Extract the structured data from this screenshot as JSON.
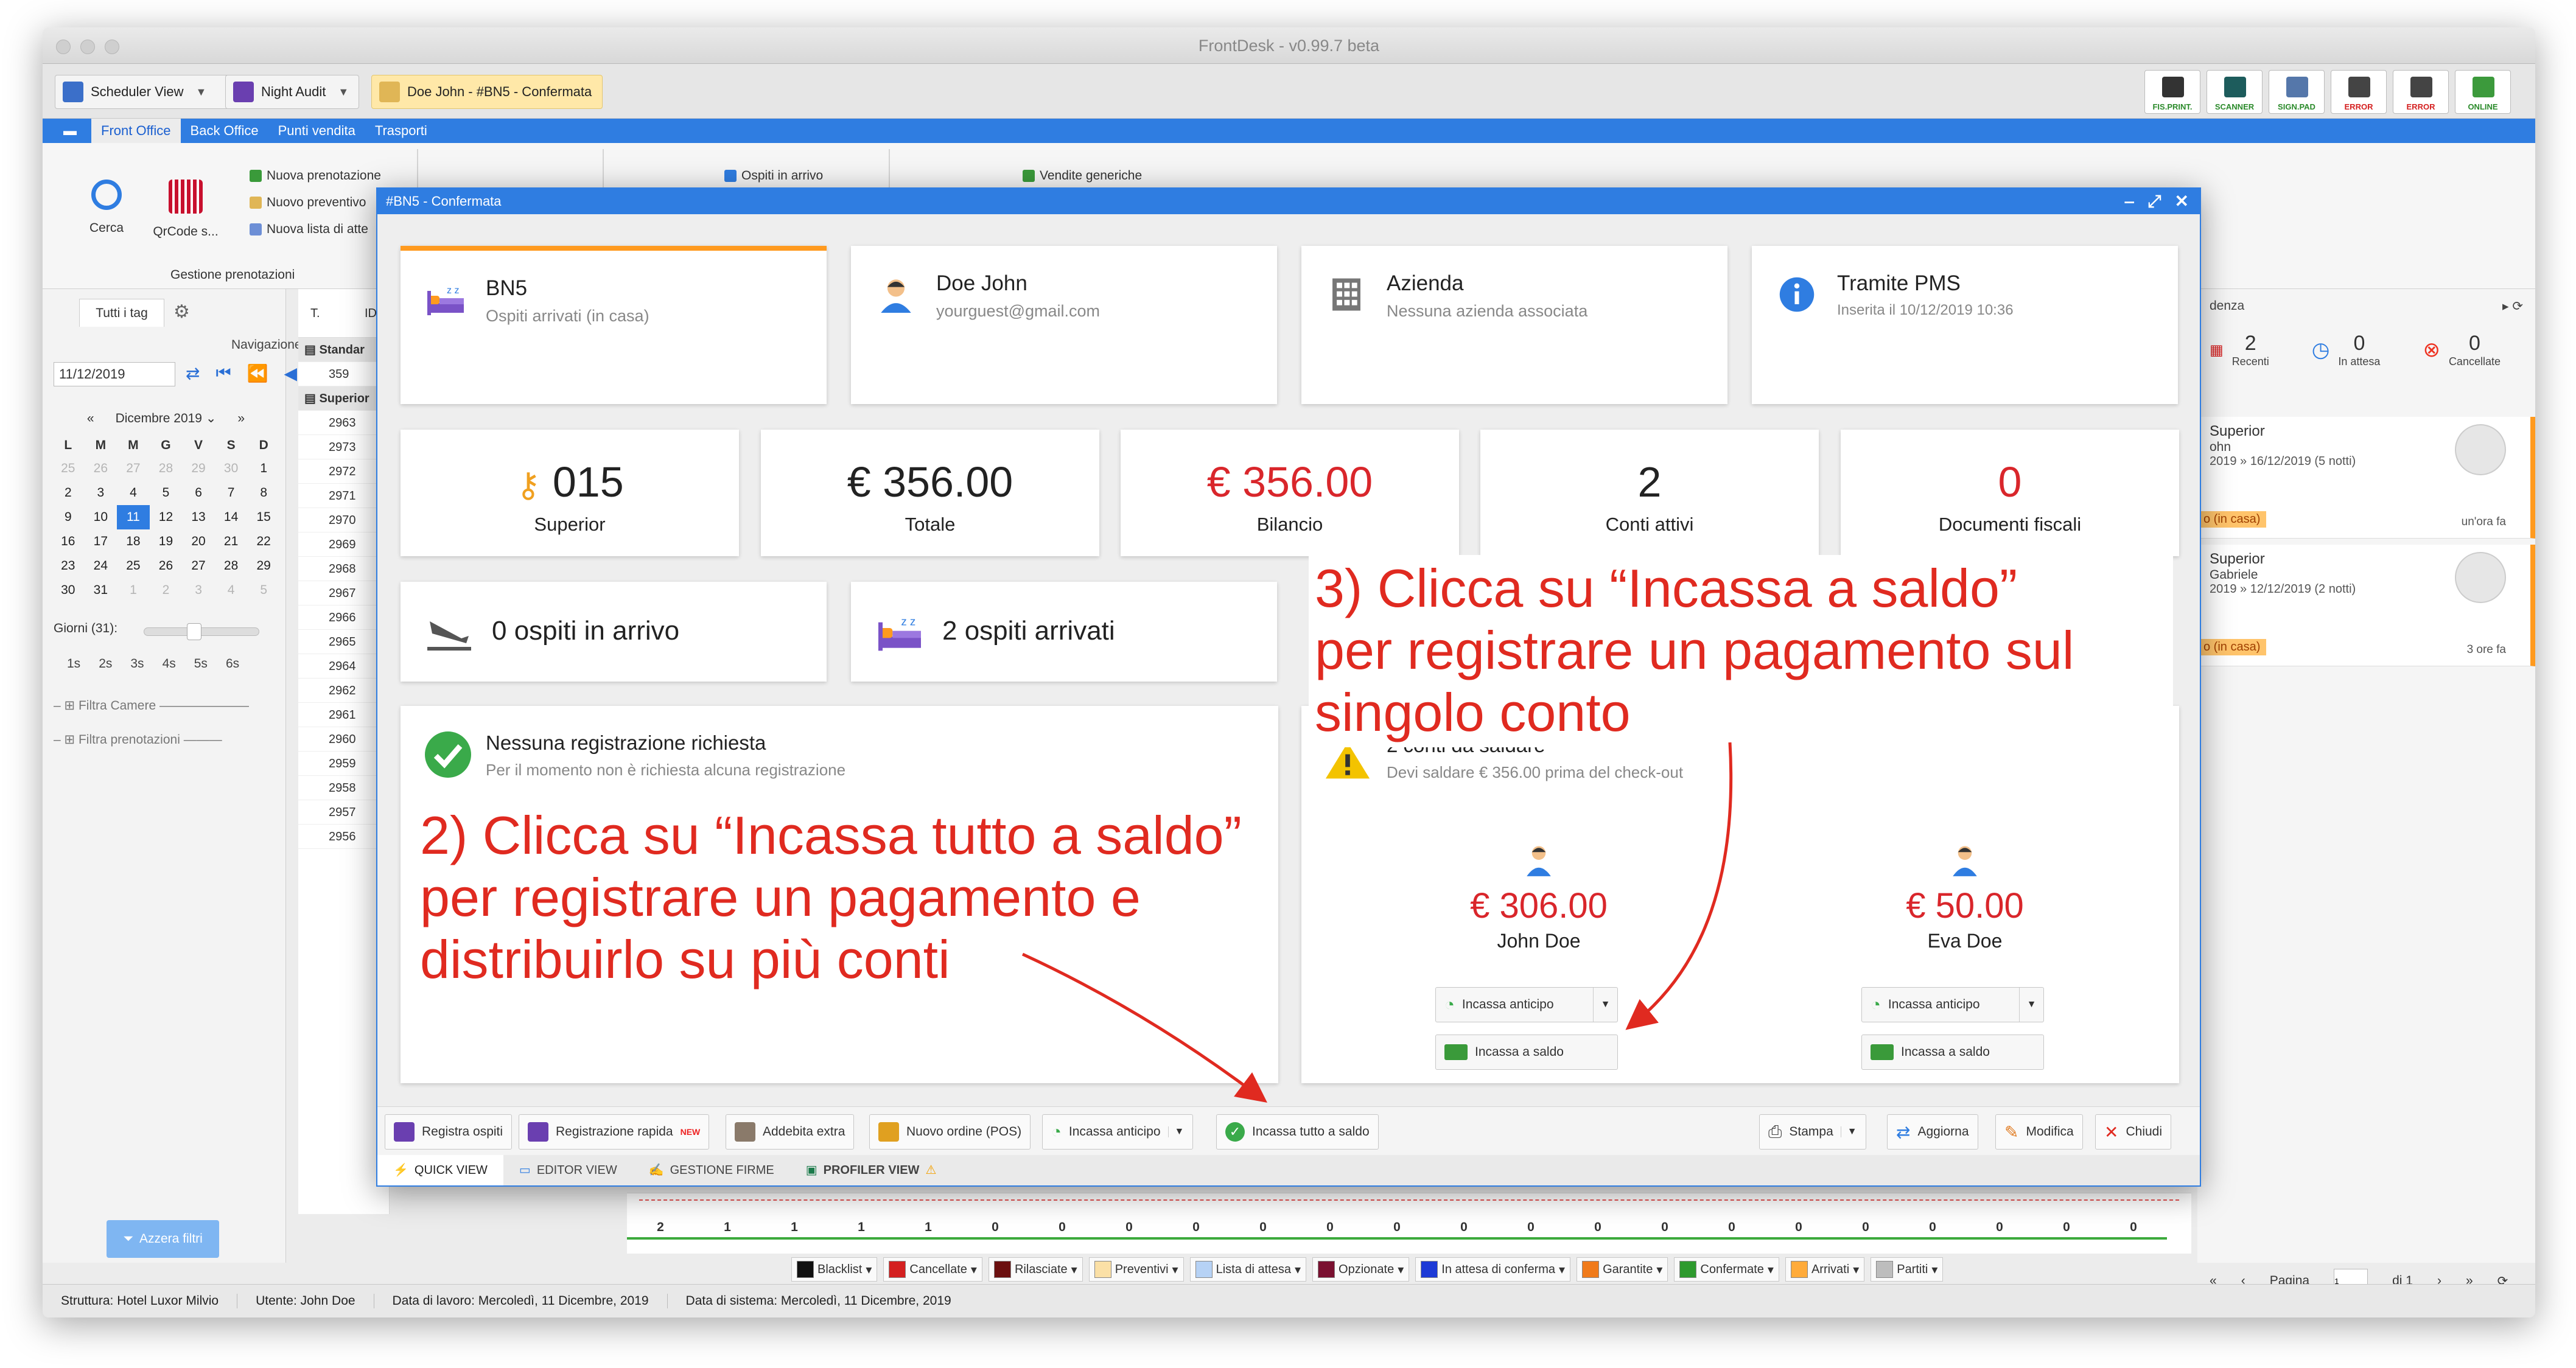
{
  "window": {
    "title": "FrontDesk - v0.99.7 beta"
  },
  "toolbar": {
    "scheduler_view": "Scheduler View",
    "night_audit": "Night Audit",
    "reservation_tab": "Doe John - #BN5 - Confermata",
    "devices": [
      "FIS.PRINT.",
      "SCANNER",
      "SIGN.PAD",
      "ERROR",
      "ERROR",
      "ONLINE"
    ]
  },
  "menu": {
    "items": [
      "Front Office",
      "Back Office",
      "Punti vendita",
      "Trasporti"
    ]
  },
  "ribbon": {
    "cerca": "Cerca",
    "qrcode": "QrCode s...",
    "nuova_prenotazione": "Nuova prenotazione",
    "nuovo_preventivo": "Nuovo preventivo",
    "nuova_lista": "Nuova lista di atte",
    "group_label": "Gestione prenotazioni",
    "ospiti_in_arrivo": "Ospiti in arrivo",
    "vendite_generiche": "Vendite generiche"
  },
  "left": {
    "tab": "Tutti i tag",
    "navigazione": "Navigazione",
    "date": "11/12/2019",
    "month": "Dicembre 2019",
    "weekdays": [
      "L",
      "M",
      "M",
      "G",
      "V",
      "S",
      "D"
    ],
    "weeks": [
      [
        "25",
        "26",
        "27",
        "28",
        "29",
        "30",
        "1"
      ],
      [
        "2",
        "3",
        "4",
        "5",
        "6",
        "7",
        "8"
      ],
      [
        "9",
        "10",
        "11",
        "12",
        "13",
        "14",
        "15"
      ],
      [
        "16",
        "17",
        "18",
        "19",
        "20",
        "21",
        "22"
      ],
      [
        "23",
        "24",
        "25",
        "26",
        "27",
        "28",
        "29"
      ],
      [
        "30",
        "31",
        "1",
        "2",
        "3",
        "4",
        "5"
      ]
    ],
    "giorni": "Giorni (31):",
    "spans": [
      "1s",
      "2s",
      "3s",
      "4s",
      "5s",
      "6s"
    ],
    "filtra_camere": "Filtra Camere",
    "filtra_prenotazioni": "Filtra prenotazioni",
    "azzera": "Azzera filtri"
  },
  "grid": {
    "col_t": "T.",
    "col_id": "ID",
    "group1": "Standar",
    "group1_rooms": [
      "359"
    ],
    "group2": "Superior",
    "group2_rooms": [
      "2963",
      "2973",
      "2972",
      "2971",
      "2970",
      "2969",
      "2968",
      "2967",
      "2966",
      "2965",
      "2964",
      "2962",
      "2961",
      "2960",
      "2959",
      "2958",
      "2957",
      "2956"
    ],
    "counts": [
      "2",
      "1",
      "1",
      "1",
      "1",
      "0",
      "0",
      "0",
      "0",
      "0",
      "0",
      "0",
      "0",
      "0",
      "0",
      "0",
      "0",
      "0",
      "0",
      "0",
      "0",
      "0",
      "0"
    ]
  },
  "legend": [
    "Blacklist",
    "Cancellate",
    "Rilasciate",
    "Preventivi",
    "Lista di attesa",
    "Opzionate",
    "In attesa di conferma",
    "Garantite",
    "Confermate",
    "Arrivati",
    "Partiti"
  ],
  "colors": {
    "accent": "#2f7de1",
    "red": "#d9262b",
    "orange": "#ff9a1f",
    "legend": [
      "#111111",
      "#d42020",
      "#6b0f0f",
      "#fbe0a6",
      "#b6d2f5",
      "#7a1030",
      "#1d3ad6",
      "#f07a1a",
      "#2e9a2e",
      "#ffab3a",
      "#bdbdbd"
    ]
  },
  "status": {
    "struttura": "Struttura: Hotel Luxor Milvio",
    "utente": "Utente: John Doe",
    "data_lavoro": "Data di lavoro: Mercoledì, 11 Dicembre, 2019",
    "data_sistema": "Data di sistema: Mercoledì, 11 Dicembre, 2019"
  },
  "right": {
    "header": "denza",
    "recenti": "2",
    "recenti_label": "Recenti",
    "attesa": "0",
    "attesa_label": "In attesa",
    "cancellate": "0",
    "cancellate_label": "Cancellate",
    "cards": [
      {
        "room": "Superior",
        "name": "ohn",
        "dates": "2019 » 16/12/2019 (5 notti)",
        "badge": "o (in casa)",
        "ago": "un'ora fa"
      },
      {
        "room": "Superior",
        "name": "Gabriele",
        "dates": "2019 » 12/12/2019 (2 notti)",
        "badge": "o (in casa)",
        "ago": "3 ore fa"
      }
    ],
    "pagina": "Pagina",
    "page": "1",
    "di": "di 1"
  },
  "dialog": {
    "title": "#BN5 - Confermata",
    "bn5": {
      "title": "BN5",
      "sub": "Ospiti arrivati (in casa)"
    },
    "guest": {
      "name": "Doe John",
      "email": "yourguest@gmail.com"
    },
    "azienda": {
      "title": "Azienda",
      "sub": "Nessuna azienda associata"
    },
    "pms": {
      "title": "Tramite PMS",
      "sub": "Inserita il 10/12/2019 10:36"
    },
    "stats": [
      {
        "value": "015",
        "label": "Superior"
      },
      {
        "value": "€ 356.00",
        "label": "Totale"
      },
      {
        "value": "€ 356.00",
        "label": "Bilancio"
      },
      {
        "value": "2",
        "label": "Conti attivi"
      },
      {
        "value": "0",
        "label": "Documenti fiscali"
      }
    ],
    "arrivo": "0 ospiti in arrivo",
    "arrivati": "2 ospiti arrivati",
    "registrazione": {
      "title": "Nessuna registrazione richiesta",
      "sub": "Per il momento non è richiesta alcuna registrazione"
    },
    "saldo": {
      "title": "2 conti da saldare",
      "sub": "Devi saldare € 356.00 prima del check-out"
    },
    "persons": [
      {
        "amount": "€ 306.00",
        "name": "John Doe"
      },
      {
        "amount": "€ 50.00",
        "name": "Eva Doe"
      }
    ],
    "incassa_anticipo": "Incassa anticipo",
    "incassa_saldo": "Incassa a saldo",
    "bottom": {
      "registra": "Registra ospiti",
      "rapida": "Registrazione rapida",
      "new": "NEW",
      "addebita": "Addebita extra",
      "ordine": "Nuovo ordine (POS)",
      "anticipo": "Incassa anticipo",
      "tutto": "Incassa tutto a saldo",
      "stampa": "Stampa",
      "aggiorna": "Aggiorna",
      "modifica": "Modifica",
      "chiudi": "Chiudi"
    },
    "tabs": [
      "QUICK VIEW",
      "EDITOR VIEW",
      "GESTIONE FIRME",
      "PROFILER VIEW"
    ]
  },
  "annotations": {
    "step2": [
      "2) Clicca su “Incassa tutto a saldo”",
      "per registrare un pagamento e",
      "distribuirlo su più conti"
    ],
    "step3": [
      "3) Clicca su “Incassa a saldo”",
      "per registrare un pagamento sul",
      "singolo conto"
    ]
  }
}
